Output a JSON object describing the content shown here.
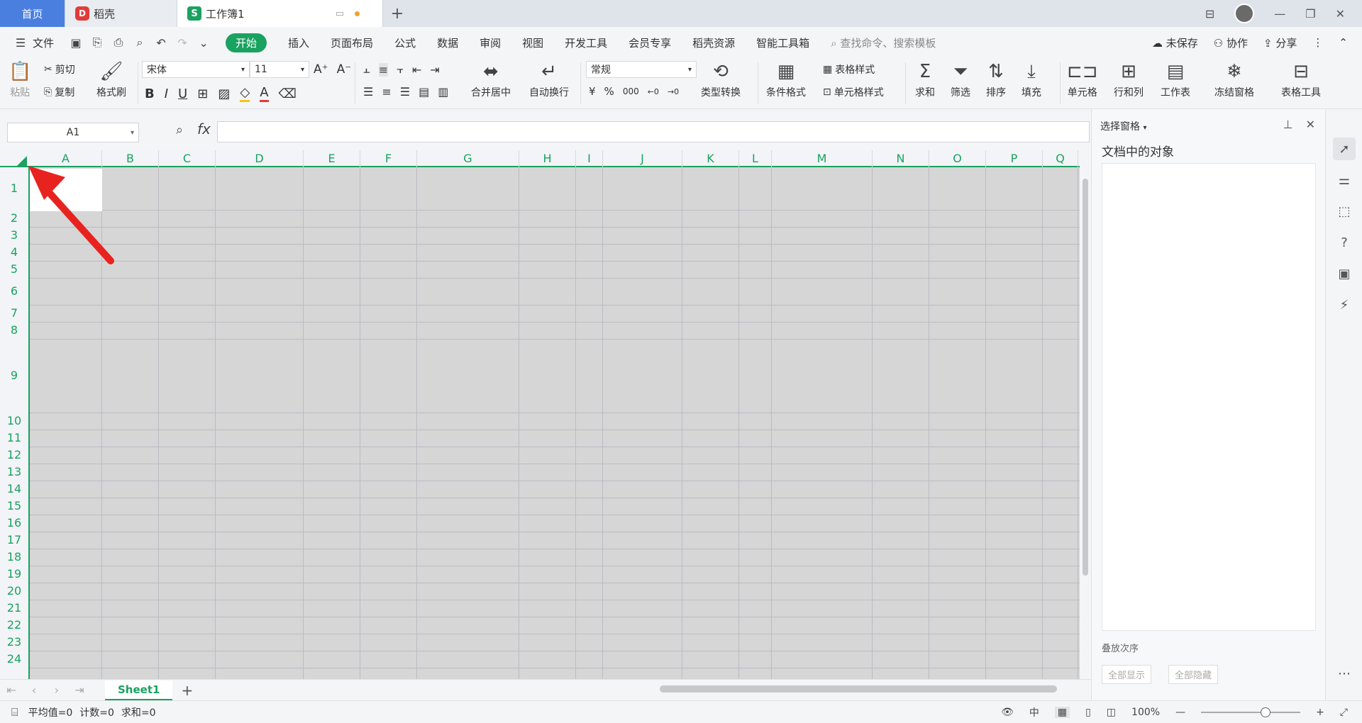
{
  "tabs": {
    "home": "首页",
    "daoke": "稻壳",
    "workbook": "工作簿1",
    "add": "+"
  },
  "menu": {
    "file": "文件",
    "items": [
      "开始",
      "插入",
      "页面布局",
      "公式",
      "数据",
      "审阅",
      "视图",
      "开发工具",
      "会员专享",
      "稻壳资源",
      "智能工具箱"
    ],
    "active_index": 0,
    "search": "查找命令、搜索模板",
    "unsaved": "未保存",
    "collab": "协作",
    "share": "分享"
  },
  "ribbon": {
    "paste": "粘贴",
    "cut": "剪切",
    "copy": "复制",
    "format_painter": "格式刷",
    "font_name": "宋体",
    "font_size": "11",
    "merge_center": "合并居中",
    "wrap": "自动换行",
    "number_format": "常规",
    "type_convert": "类型转换",
    "cond_format": "条件格式",
    "table_style": "表格样式",
    "cell_style": "单元格样式",
    "sum": "求和",
    "filter": "筛选",
    "sort": "排序",
    "fill": "填充",
    "cell": "单元格",
    "rowcol": "行和列",
    "sheet": "工作表",
    "freeze": "冻结窗格",
    "table_tools": "表格工具",
    "currency": "¥",
    "percent": "%",
    "thousands": "000"
  },
  "formula_bar": {
    "name_box": "A1",
    "fx": "fx",
    "value": ""
  },
  "grid": {
    "columns": [
      "A",
      "B",
      "C",
      "D",
      "E",
      "F",
      "G",
      "H",
      "I",
      "J",
      "K",
      "L",
      "M",
      "N",
      "O",
      "P",
      "Q"
    ],
    "rows": [
      "1",
      "2",
      "3",
      "4",
      "5",
      "6",
      "7",
      "8",
      "9",
      "10",
      "11",
      "12",
      "13",
      "14",
      "15",
      "16",
      "17",
      "18",
      "19",
      "20",
      "21",
      "22",
      "23",
      "24"
    ]
  },
  "sheets": {
    "tabs": [
      "Sheet1"
    ],
    "active": "Sheet1",
    "add": "+"
  },
  "status": {
    "average": "平均值=0",
    "count": "计数=0",
    "sum": "求和=0",
    "zoom": "100%"
  },
  "selection_pane": {
    "header": "选择窗格",
    "title": "文档中的对象",
    "order": "叠放次序",
    "show_all": "全部显示",
    "hide_all": "全部隐藏"
  },
  "colors": {
    "accent": "#1aa260",
    "tab_home": "#4a7fe0",
    "arrow": "#e8231f",
    "grid_fill": "#d6d6d6"
  }
}
